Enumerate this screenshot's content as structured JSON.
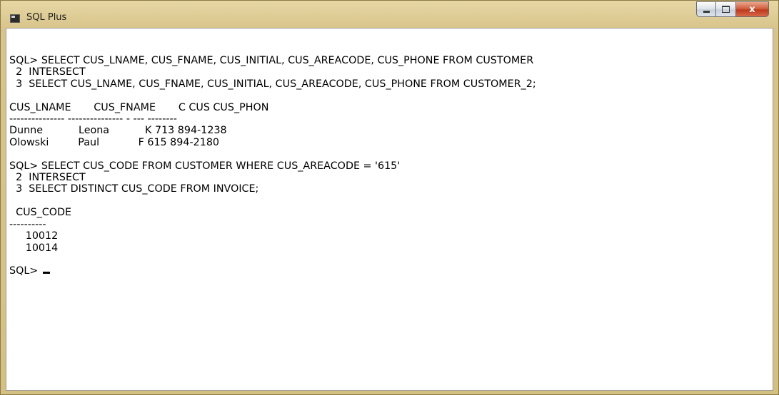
{
  "window": {
    "title": "SQL Plus",
    "app_icon": "console-icon",
    "controls": {
      "minimize": "minimize-icon",
      "maximize": "maximize-icon",
      "close": "close-icon",
      "close_glyph": "x"
    }
  },
  "console": {
    "lines": [
      "SQL> SELECT CUS_LNAME, CUS_FNAME, CUS_INITIAL, CUS_AREACODE, CUS_PHONE FROM CUSTOMER",
      "  2  INTERSECT",
      "  3  SELECT CUS_LNAME, CUS_FNAME, CUS_INITIAL, CUS_AREACODE, CUS_PHONE FROM CUSTOMER_2;",
      "",
      "CUS_LNAME       CUS_FNAME       C CUS CUS_PHON",
      "--------------- --------------- - --- --------",
      "Dunne           Leona           K 713 894-1238",
      "Olowski         Paul            F 615 894-2180",
      "",
      "SQL> SELECT CUS_CODE FROM CUSTOMER WHERE CUS_AREACODE = '615'",
      "  2  INTERSECT",
      "  3  SELECT DISTINCT CUS_CODE FROM INVOICE;",
      "",
      "  CUS_CODE",
      "----------",
      "     10012",
      "     10014",
      ""
    ],
    "prompt": "SQL> "
  }
}
